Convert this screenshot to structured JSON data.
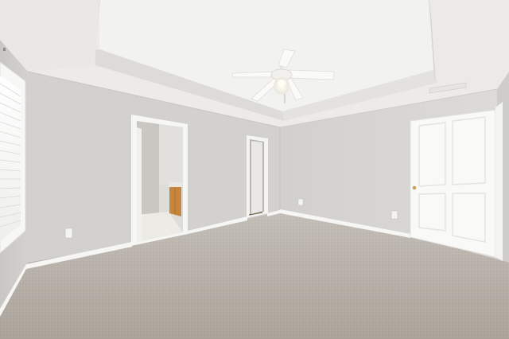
{
  "scene": {
    "colors": {
      "ceiling": "#eeeeec",
      "tray_ceiling": "#f3f3f2",
      "tray_band": "#dedcd8",
      "wall_back": "#d4d2ce",
      "wall_left": "#cfcdc9",
      "wall_right": "#d8d6d2",
      "carpet": "#b6b0a8",
      "baseboard": "#f7f7f5",
      "door": "#fafaf9",
      "trim": "#f5f5f3",
      "cabinet": "#c8873e",
      "bath_floor": "#ebe8e2",
      "fan_blade": "#fbfbfa"
    }
  }
}
